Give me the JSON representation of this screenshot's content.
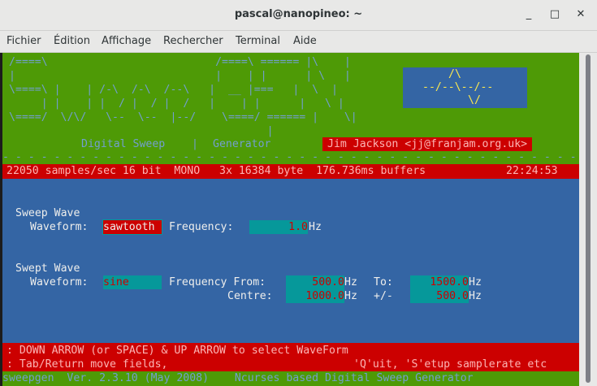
{
  "window": {
    "title": "pascal@nanopineo: ~",
    "minimize": "_",
    "maximize": "□",
    "close": "✕"
  },
  "menu": [
    "Fichier",
    "Édition",
    "Affichage",
    "Rechercher",
    "Terminal",
    "Aide"
  ],
  "banner": {
    "logo_lines": [
      "/====\\                          /====\\ ====== |\\    |",
      "|                               |    | |      | \\   |",
      "\\====\\ |    | /-\\  /-\\  /--\\   |  __ |===   |  \\  |",
      "     | |    | |  / |  / |  /   |    | |      |   \\ |",
      "\\====/  \\/\\/   \\--  \\--  |--/    \\====/ ====== |    \\|",
      "                                        |"
    ],
    "wave_lines": [
      "/\\",
      "--/--\\--/--",
      "\\/"
    ],
    "subtitle_left": "Digital Sweep",
    "subtitle_sep": "|",
    "subtitle_right": "Generator",
    "author": "Jim Jackson <jj@franjam.org.uk>",
    "separator": "- - - - - - - - - - - - - - - - - - - - - - - - - - - - - - - - - - - - - - - - - - - - - - - -"
  },
  "status": {
    "text": "22050 samples/sec 16 bit  MONO   3x 16384 byte  176.736ms buffers",
    "clock": "22:24:53"
  },
  "sweep": {
    "heading": "Sweep Wave",
    "waveform_label": "Waveform:",
    "waveform_value": "sawtooth",
    "frequency_label": "Frequency:",
    "frequency_value": "1.0",
    "unit": "Hz"
  },
  "swept": {
    "heading": "Swept Wave",
    "waveform_label": "Waveform:",
    "waveform_value": "sine",
    "from_label": "Frequency From:",
    "from_value": "500.0",
    "to_label": "To:",
    "to_value": "1500.0",
    "centre_label": "Centre:",
    "centre_value": "1000.0",
    "pm_label": "+/-",
    "pm_value": "500.0",
    "unit": "Hz"
  },
  "help": {
    "line1": ": DOWN ARROW (or SPACE) & UP ARROW to select WaveForm",
    "line2_left": ": Tab/Return move fields,",
    "line2_right": "'Q'uit, 'S'etup samplerate etc"
  },
  "footer": "sweepgen  Ver. 2.3.10 (May 2008)    Ncurses based Digital Sweep Generator"
}
